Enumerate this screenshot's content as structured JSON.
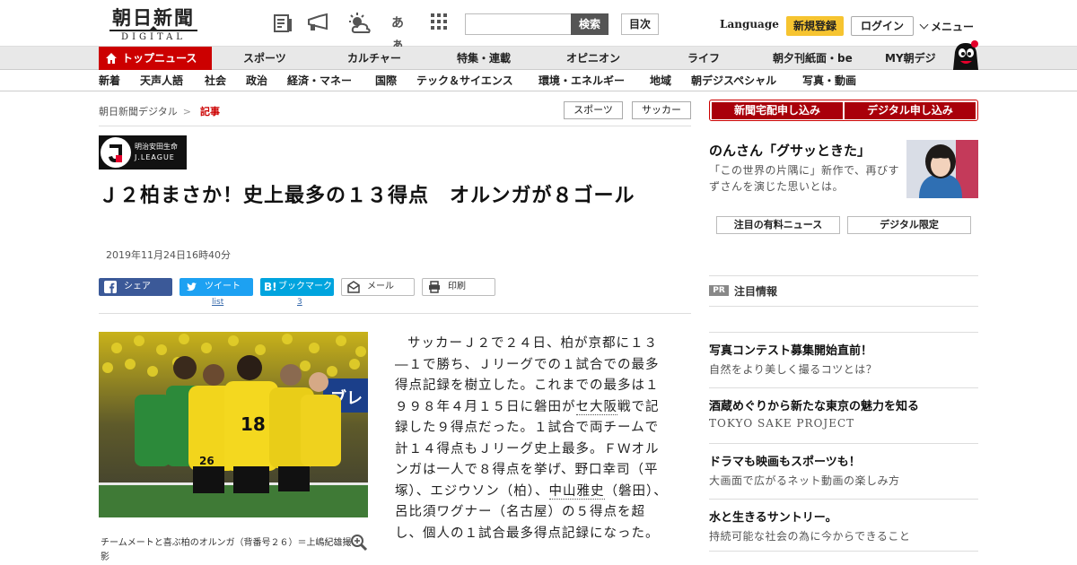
{
  "header": {
    "logo_main": "朝日新聞",
    "logo_sub": "DIGITAL",
    "search_button": "検索",
    "toc_button": "目次",
    "language": "Language",
    "register": "新規登録",
    "login": "ログイン",
    "menu": "メニュー",
    "font_size_icon_label": "あぁ"
  },
  "main_nav": [
    "トップニュース",
    "スポーツ",
    "カルチャー",
    "特集・連載",
    "オピニオン",
    "ライフ",
    "朝夕刊紙面・be",
    "MY朝デジ"
  ],
  "sub_nav": [
    "新着",
    "天声人語",
    "社会",
    "政治",
    "経済・マネー",
    "国際",
    "テック＆サイエンス",
    "環境・エネルギー",
    "地域",
    "朝デジスペシャル",
    "写真・動画"
  ],
  "breadcrumb": {
    "home": "朝日新聞デジタル",
    "sep": ">",
    "current": "記事"
  },
  "tags": [
    "スポーツ",
    "サッカー"
  ],
  "jleague": {
    "line1": "明治安田生命",
    "line2": "J.LEAGUE"
  },
  "article": {
    "headline": "Ｊ２柏まさか！史上最多の１３得点　オルンガが８ゴール",
    "date": "2019年11月24日16時40分",
    "caption": "チームメートと喜ぶ柏のオルンガ（背番号２６）＝上嶋紀雄撮影",
    "body_1": "サッカーＪ２で２４日、柏が京都に１３―１で勝ち、Ｊリーグでの１試合での最多得点記録を樹立した。これまでの最多は１９９８年４月１５日に磐田が",
    "link_1": "セ大阪",
    "body_2": "戦で記録した９得点だった。１試合で両チームで計１４得点もＪリーグ史上最多。ＦＷオルンガは一人で８得点を挙げ、野口幸司（平塚）、エジウソン（柏）、",
    "link_2": "中山雅史",
    "body_3": "（磐田）、呂比須ワグナー（名古屋）の５得点を超し、個人の１試合最多得点記録になった。"
  },
  "share": {
    "facebook": "シェア",
    "twitter": "ツイート",
    "hatena": "ブックマーク",
    "mail": "メール",
    "print": "印刷",
    "twitter_count": "list",
    "hatena_count": "3"
  },
  "sidebar": {
    "subscribe_paper": "新聞宅配申し込み",
    "subscribe_digital": "デジタル申し込み",
    "feature_title": "のんさん「グサッときた」",
    "feature_desc": "「この世界の片隅に」新作で、再びすずさんを演じた思いとは。",
    "btn_paid": "注目の有料ニュース",
    "btn_digital": "デジタル限定",
    "pr_badge": "PR",
    "pr_title": "注目情報",
    "ads": [
      {
        "title": "写真コンテスト募集開始直前！",
        "sub": "自然をより美しく撮るコツとは？"
      },
      {
        "title": "酒蔵めぐりから新たな東京の魅力を知る",
        "sub": "TOKYO SAKE PROJECT"
      },
      {
        "title": "ドラマも映画もスポーツも！",
        "sub": "大画面で広がるネット動画の楽しみ方"
      },
      {
        "title": "水と生きるサントリー。",
        "sub": "持続可能な社会の為に今からできること"
      }
    ]
  },
  "colors": {
    "brand_red": "#cc0000",
    "register_yellow": "#f6c430",
    "facebook": "#3b5998",
    "twitter": "#1da1f2",
    "hatena": "#00a4de"
  }
}
